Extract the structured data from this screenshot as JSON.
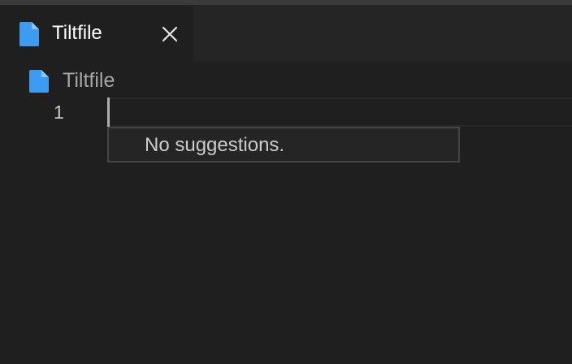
{
  "tab": {
    "label": "Tiltfile",
    "icon": "file-icon",
    "close_icon": "close-icon"
  },
  "breadcrumb": {
    "label": "Tiltfile",
    "icon": "file-icon"
  },
  "editor": {
    "line_number": "1"
  },
  "suggest_widget": {
    "message": "No suggestions."
  },
  "colors": {
    "file_icon": "#3d9cf2",
    "background": "#1f1f1f",
    "tab_bar": "#252526"
  }
}
